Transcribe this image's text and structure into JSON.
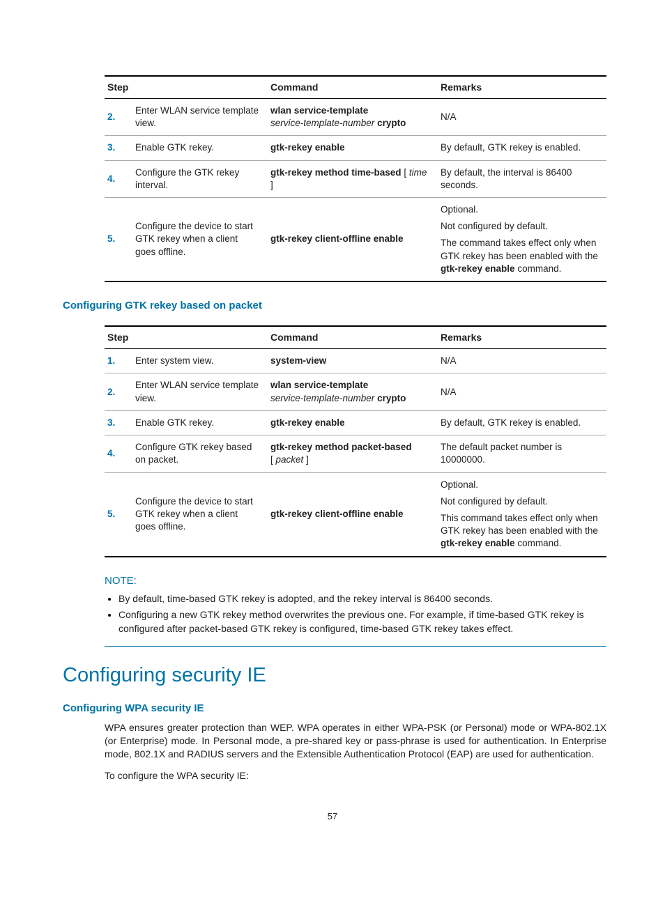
{
  "table1": {
    "head": {
      "c1": "Step",
      "c2": "Command",
      "c3": "Remarks"
    },
    "rows": [
      {
        "n": "2.",
        "step": "Enter WLAN service template view.",
        "cmd_b1": "wlan service-template",
        "cmd_i": "service-template-number",
        "cmd_b2": "crypto",
        "rem": "N/A"
      },
      {
        "n": "3.",
        "step": "Enable GTK rekey.",
        "cmd_b1": "gtk-rekey enable",
        "rem": "By default, GTK rekey is enabled."
      },
      {
        "n": "4.",
        "step": "Configure the GTK rekey interval.",
        "cmd_b1": "gtk-rekey method time-based",
        "cmd_br_open": " [ ",
        "cmd_i": "time",
        "cmd_br_close": " ]",
        "rem": "By default, the interval is 86400 seconds."
      },
      {
        "n": "5.",
        "step": "Configure the device to start GTK rekey when a client goes offline.",
        "cmd_b1": "gtk-rekey client-offline enable",
        "rem1": "Optional.",
        "rem2": "Not configured by default.",
        "rem3a": "The command takes effect only when GTK rekey has been enabled with the ",
        "rem3b": "gtk-rekey enable",
        "rem3c": " command."
      }
    ]
  },
  "sub1": "Configuring GTK rekey based on packet",
  "table2": {
    "head": {
      "c1": "Step",
      "c2": "Command",
      "c3": "Remarks"
    },
    "rows": [
      {
        "n": "1.",
        "step": "Enter system view.",
        "cmd_b1": "system-view",
        "rem": "N/A"
      },
      {
        "n": "2.",
        "step": "Enter WLAN service template view.",
        "cmd_b1": "wlan service-template",
        "cmd_i": "service-template-number",
        "cmd_b2": "crypto",
        "rem": "N/A"
      },
      {
        "n": "3.",
        "step": "Enable GTK rekey.",
        "cmd_b1": "gtk-rekey enable",
        "rem": "By default, GTK rekey is enabled."
      },
      {
        "n": "4.",
        "step": "Configure GTK rekey based on packet.",
        "cmd_b1": "gtk-rekey method packet-based",
        "cmd_br_open": "[ ",
        "cmd_i": "packet",
        "cmd_br_close": " ]",
        "rem": "The default packet number is 10000000."
      },
      {
        "n": "5.",
        "step": "Configure the device to start GTK rekey when a client goes offline.",
        "cmd_b1": "gtk-rekey client-offline enable",
        "rem1": "Optional.",
        "rem2": "Not configured by default.",
        "rem3a": "This command takes effect only when GTK rekey has been enabled with the ",
        "rem3b": "gtk-rekey enable",
        "rem3c": " command."
      }
    ]
  },
  "note": {
    "label": "NOTE:",
    "items": [
      "By default, time-based GTK rekey is adopted, and the rekey interval is 86400 seconds.",
      "Configuring a new GTK rekey method overwrites the previous one. For example, if time-based GTK rekey is configured after packet-based GTK rekey is configured, time-based GTK rekey takes effect."
    ]
  },
  "section_title": "Configuring security IE",
  "sub2": "Configuring WPA security IE",
  "para1": "WPA ensures greater protection than WEP. WPA operates in either WPA-PSK (or Personal) mode or WPA-802.1X (or Enterprise) mode. In Personal mode, a pre-shared key or pass-phrase is used for authentication. In Enterprise mode, 802.1X and RADIUS servers and the Extensible Authentication Protocol (EAP) are used for authentication.",
  "para2": "To configure the WPA security IE:",
  "page": "57"
}
